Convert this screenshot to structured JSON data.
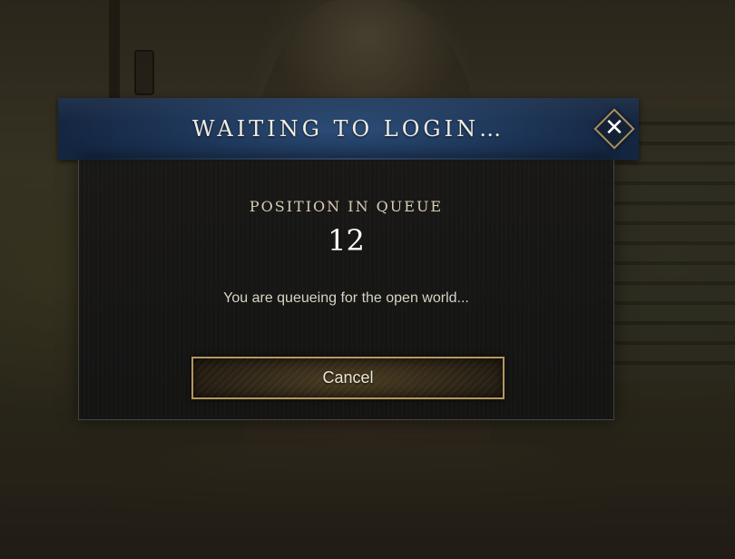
{
  "dialog": {
    "title": "WAITING TO LOGIN…",
    "close_icon": "close-icon",
    "queue_label": "POSITION IN QUEUE",
    "queue_position": "12",
    "message": "You are queueing for the open world...",
    "cancel_label": "Cancel"
  },
  "colors": {
    "header_blue": "#1d3557",
    "gold_border": "#b4985f",
    "body_dark": "#161616"
  }
}
